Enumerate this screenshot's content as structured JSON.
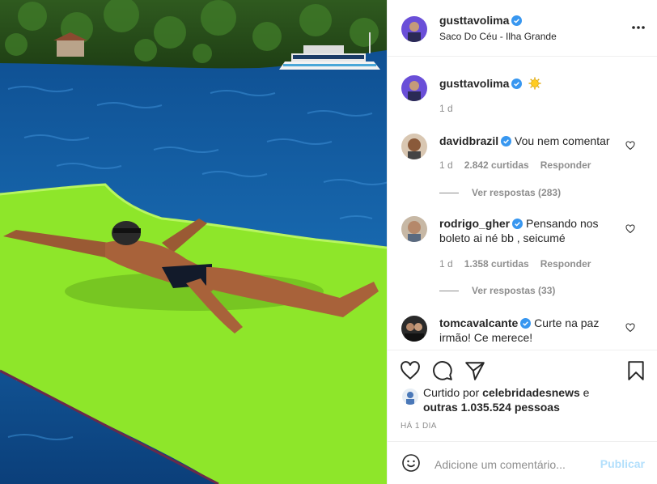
{
  "header": {
    "username": "gusttavolima",
    "location": "Saco Do Céu - Ilha Grande",
    "more_icon": "more-horizontal-icon"
  },
  "caption": {
    "username": "gusttavolima",
    "emoji": "sun-emoji",
    "time": "1 d"
  },
  "comments": [
    {
      "username": "davidbrazil",
      "text": "Vou nem comentar",
      "time": "1 d",
      "likes": "2.842 curtidas",
      "reply": "Responder",
      "view_replies": "Ver respostas (283)"
    },
    {
      "username": "rodrigo_gher",
      "text": "Pensando nos boleto ai né bb , seicumé",
      "time": "1 d",
      "likes": "1.358 curtidas",
      "reply": "Responder",
      "view_replies": "Ver respostas (33)"
    },
    {
      "username": "tomcavalcante",
      "text": "Curte na paz irmão! Ce merece!"
    }
  ],
  "actions": {
    "liked_by_prefix": "Curtido por",
    "liked_by_user": "celebridadesnews",
    "liked_by_joiner": "e",
    "liked_by_others": "outras 1.035.524 pessoas",
    "timestamp": "HÁ 1 DIA"
  },
  "add_comment": {
    "placeholder": "Adicione um comentário...",
    "publish_label": "Publicar"
  },
  "colors": {
    "verified": "#3897f0",
    "publish_disabled": "#b2dffc",
    "mat": "#8ee62a"
  }
}
